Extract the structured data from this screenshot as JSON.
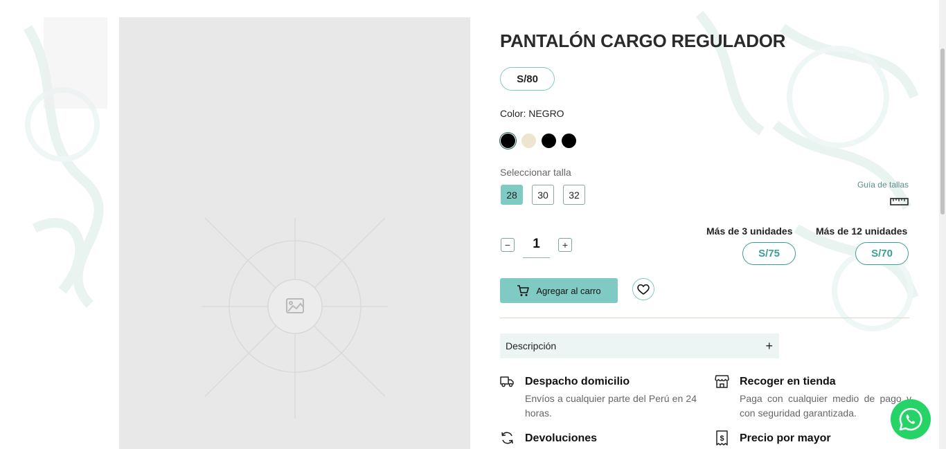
{
  "product": {
    "title": "PANTALÓN CARGO REGULADOR",
    "price": "S/80",
    "color_label": "Color: NEGRO",
    "swatches": [
      {
        "color": "#000000",
        "selected": true
      },
      {
        "color": "#ede5d0",
        "selected": false
      },
      {
        "color": "#000000",
        "selected": false
      },
      {
        "color": "#000000",
        "selected": false
      }
    ]
  },
  "sizes": {
    "label": "Seleccionar talla",
    "options": [
      "28",
      "30",
      "32"
    ],
    "selected": "28",
    "guide_label": "Guía de tallas"
  },
  "quantity": {
    "minus": "−",
    "plus": "+",
    "value": "1"
  },
  "tiers": [
    {
      "label": "Más de 3 unidades",
      "price": "S/75"
    },
    {
      "label": "Más de 12 unidades",
      "price": "S/70"
    }
  ],
  "actions": {
    "add_to_cart": "Agregar al carro"
  },
  "accordion": {
    "label": "Descripción",
    "toggle": "+"
  },
  "features": [
    {
      "title": "Despacho domicilio",
      "desc": "Envíos a cualquier parte del Perú en 24 horas.",
      "icon": "truck-icon"
    },
    {
      "title": "Recoger en tienda",
      "desc": "Paga con cualquier medio de pago y con seguridad garantizada.",
      "icon": "store-icon"
    },
    {
      "title": "Devoluciones",
      "desc": "",
      "icon": "refresh-icon"
    },
    {
      "title": "Precio por mayor",
      "desc": "",
      "icon": "receipt-dollar-icon"
    }
  ],
  "colors": {
    "accent": "#7fcbc3",
    "accent_dark": "#3a9e95",
    "whatsapp": "#25d366"
  }
}
